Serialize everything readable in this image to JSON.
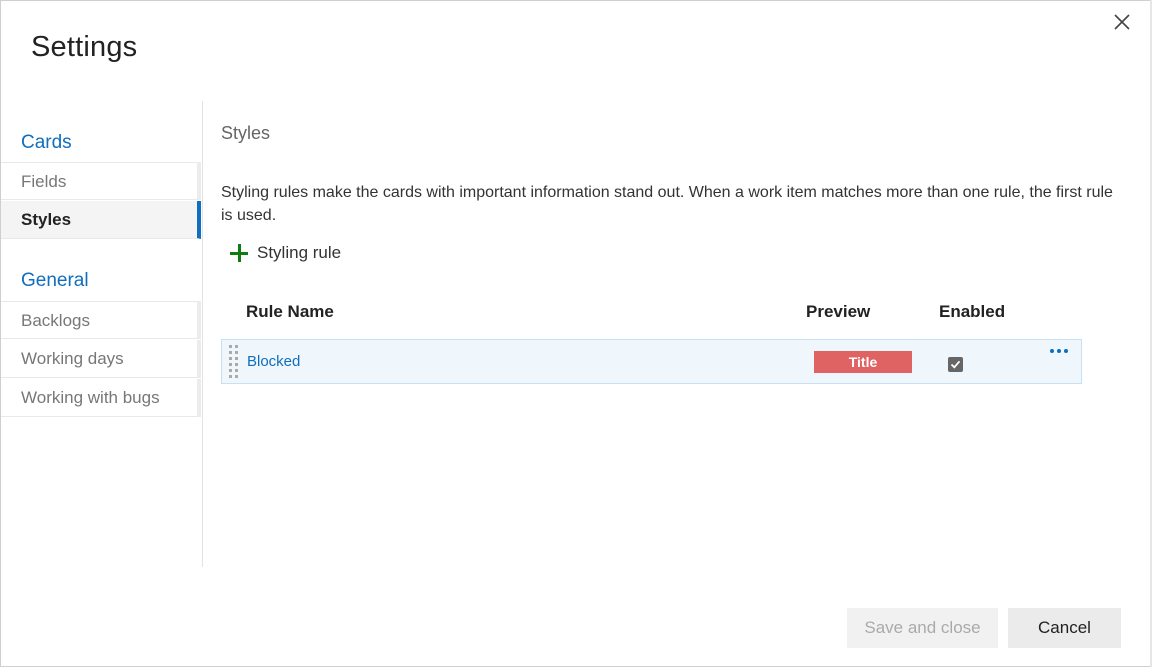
{
  "dialog": {
    "title": "Settings"
  },
  "sidebar": {
    "cards_section": "Cards",
    "cards_items": [
      {
        "label": "Fields"
      },
      {
        "label": "Styles"
      }
    ],
    "general_section": "General",
    "general_items": [
      {
        "label": "Backlogs"
      },
      {
        "label": "Working days"
      },
      {
        "label": "Working with bugs"
      }
    ]
  },
  "content": {
    "heading": "Styles",
    "description": "Styling rules make the cards with important information stand out. When a work item matches more than one rule, the first rule is used.",
    "add_rule_label": "Styling rule",
    "columns": {
      "rule_name": "Rule Name",
      "preview": "Preview",
      "enabled": "Enabled"
    },
    "rules": [
      {
        "name": "Blocked",
        "preview_text": "Title",
        "preview_color": "#e06363",
        "enabled": true
      }
    ]
  },
  "footer": {
    "save_label": "Save and close",
    "cancel_label": "Cancel"
  },
  "colors": {
    "accent": "#106ebe",
    "add_icon": "#107c10"
  }
}
